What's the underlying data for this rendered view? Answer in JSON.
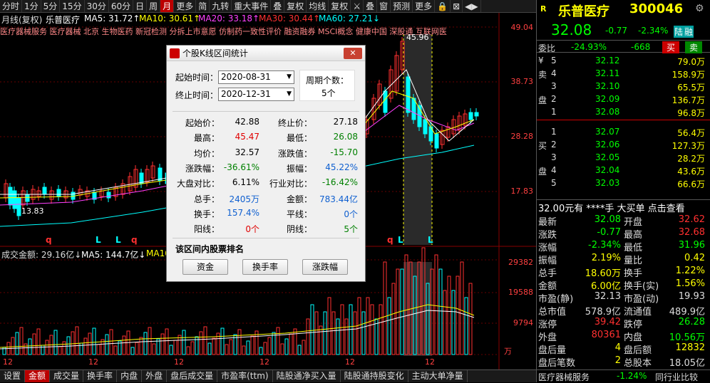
{
  "toolbar": {
    "items": [
      "分时",
      "1分",
      "5分",
      "15分",
      "30分",
      "60分",
      "日",
      "周",
      "月",
      "更多",
      "简",
      "九转",
      "重大事件",
      "叠",
      "复权",
      "均线",
      "复权",
      "⚔",
      "叠",
      "窗",
      "预测",
      "更多",
      "🔒",
      "⊠",
      "◀▶"
    ],
    "active_index": 8
  },
  "chart": {
    "title": "月线(复权)",
    "name": "乐普医疗",
    "ma5": "MA5: 31.72↑",
    "ma10": "MA10: 30.61↑",
    "ma20": "MA20: 33.18↑",
    "ma30": "MA30: 30.44↑",
    "ma60": "MA60: 27.21↓",
    "concepts": "医疗器械服务 医疗器械 北京 生物医药 新冠检测 分拆上市意愿 仿制药一致性评价 融资融券 MSCI概念 健康中国 深股通 互联网医",
    "price_labels": [
      "49.04",
      "38.73",
      "28.28",
      "17.83"
    ],
    "low_label": "13.83",
    "high_label": "45.96",
    "date_label": "12",
    "vol_title": "成交金额: 29.16亿↓",
    "vol_ma5": "MA5: 144.7亿↓",
    "vol_ma10": "MA10",
    "vol_labels": [
      "29382",
      "19588",
      "9794",
      "万"
    ],
    "x_labels": [
      "12",
      "12",
      "12",
      "12",
      "12"
    ],
    "markers": [
      "q",
      "L",
      "L",
      "q",
      "q",
      "L",
      "L"
    ]
  },
  "dialog": {
    "title": "个股K线区间统计",
    "start_label": "起始时间：",
    "start_value": "2020-08-31",
    "end_label": "终止时间：",
    "end_value": "2020-12-31",
    "period_label": "周期个数：",
    "period_value": "5个",
    "stats": [
      [
        "起始价：",
        "42.88",
        "终止价：",
        "27.18"
      ],
      [
        "最高：",
        "45.47",
        "最低：",
        "26.08"
      ],
      [
        "均价：",
        "32.57",
        "涨跌值：",
        "-15.70"
      ],
      [
        "涨跌幅：",
        "-36.61%",
        "振幅：",
        "45.22%"
      ],
      [
        "大盘对比：",
        "6.11%",
        "行业对比：",
        "-16.42%"
      ],
      [
        "总手：",
        "2405万",
        "金额：",
        "783.44亿"
      ],
      [
        "换手：",
        "157.4%",
        "平线：",
        "0个"
      ],
      [
        "阳线：",
        "0个",
        "阴线：",
        "5个"
      ]
    ],
    "rank_title": "该区间内股票排名",
    "buttons": [
      "资金",
      "换手率",
      "涨跌幅"
    ]
  },
  "panel": {
    "r": "R",
    "name": "乐普医疗",
    "code": "300046",
    "price": "32.08",
    "change": "-0.77",
    "pct": "-2.34%",
    "tag1": "陆",
    "tag2": "融",
    "weibi_label": "委比",
    "weibi": "-24.93%",
    "weicha": "-668",
    "buy_btn": "买",
    "sell_btn": "卖",
    "sell_rows": [
      [
        "¥",
        "5",
        "32.12",
        "79.0万"
      ],
      [
        "卖",
        "4",
        "32.11",
        "158.9万"
      ],
      [
        "",
        "3",
        "32.10",
        "65.5万"
      ],
      [
        "盘",
        "2",
        "32.09",
        "136.7万"
      ],
      [
        "",
        "1",
        "32.08",
        "96.8万"
      ]
    ],
    "buy_rows": [
      [
        "",
        "1",
        "32.07",
        "56.4万"
      ],
      [
        "买",
        "2",
        "32.06",
        "127.3万"
      ],
      [
        "",
        "3",
        "32.05",
        "28.2万"
      ],
      [
        "盘",
        "4",
        "32.04",
        "43.6万"
      ],
      [
        "",
        "5",
        "32.03",
        "66.6万"
      ]
    ],
    "bigorder": "32.00元有 ****手 大买单 点击查看",
    "quotes": [
      [
        "最新",
        "32.08",
        "开盘",
        "32.62"
      ],
      [
        "涨跌",
        "-0.77",
        "最高",
        "32.68"
      ],
      [
        "涨幅",
        "-2.34%",
        "最低",
        "31.96"
      ],
      [
        "振幅",
        "2.19%",
        "量比",
        "0.42"
      ],
      [
        "总手",
        "18.60万",
        "换手",
        "1.22%"
      ],
      [
        "金额",
        "6.00亿",
        "换手(实)",
        "1.56%"
      ],
      [
        "市盈(静)",
        "32.13",
        "市盈(动)",
        "19.93"
      ],
      [
        "总市值",
        "578.9亿",
        "流通值",
        "489.9亿"
      ],
      [
        "涨停",
        "39.42",
        "跌停",
        "26.28"
      ],
      [
        "外盘",
        "80361",
        "内盘",
        "10.56万"
      ],
      [
        "盘后量",
        "4",
        "盘后额",
        "12832"
      ],
      [
        "盘后笔数",
        "2",
        "总股本",
        "18.05亿"
      ]
    ],
    "sector": "医疗器械服务",
    "sector_pct": "-1.24%",
    "compare": "同行业比较"
  },
  "bottomtabs": [
    "设置",
    "金额",
    "成交量",
    "换手率",
    "内盘",
    "外盘",
    "盘后成交量",
    "市盈率(ttm)",
    "陆股通净买入量",
    "陆股通持股变化",
    "主动大单净量"
  ],
  "colors": {
    "up": "#ff3030",
    "down": "#00ffff",
    "yellow": "#ffff00",
    "bg": "#000000"
  }
}
